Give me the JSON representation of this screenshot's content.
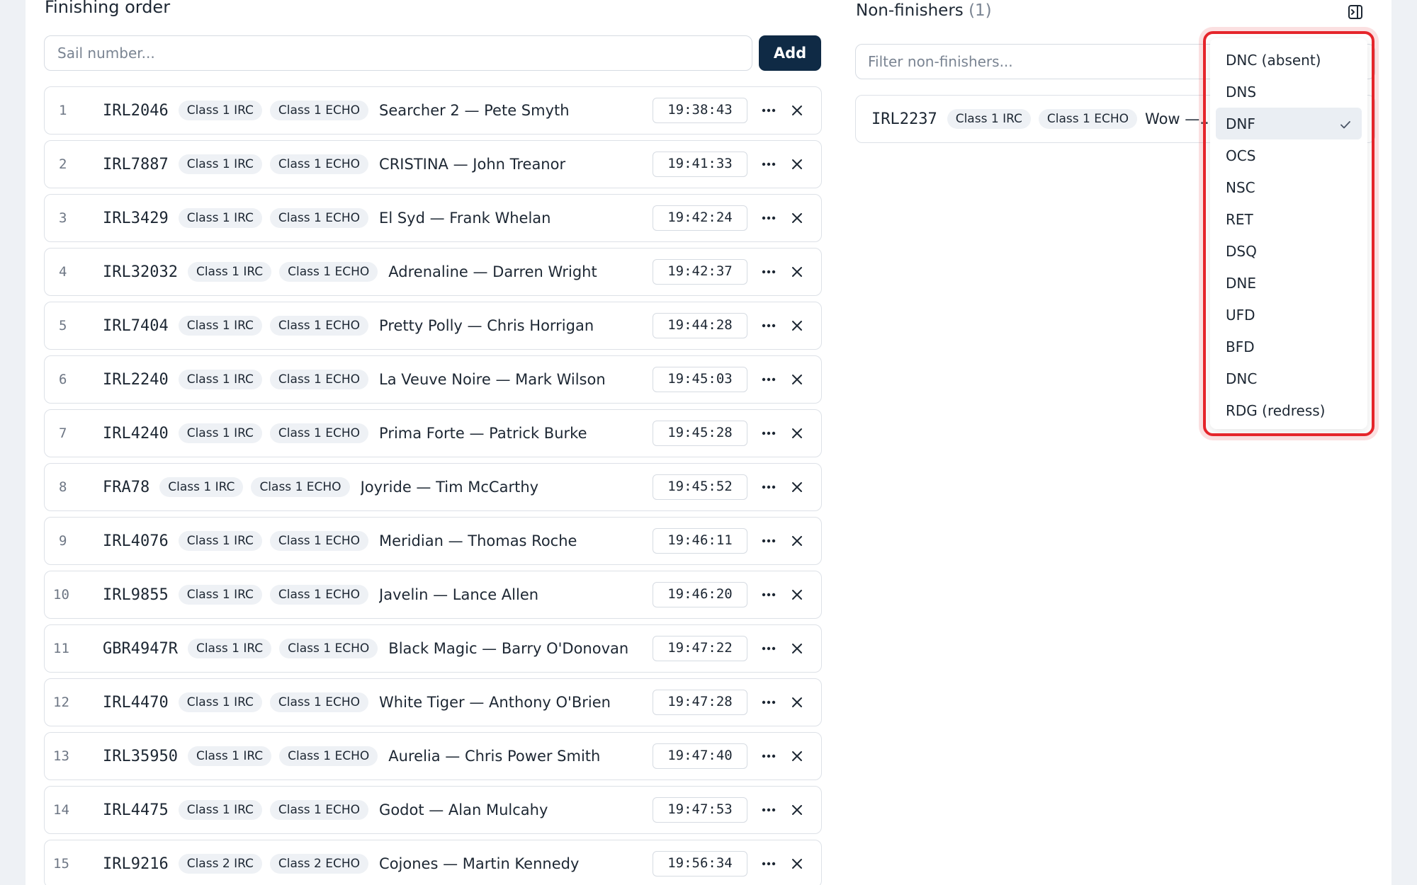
{
  "finishing": {
    "title": "Finishing order",
    "sail_placeholder": "Sail number...",
    "add_label": "Add",
    "rows": [
      {
        "pos": "1",
        "sail": "IRL2046",
        "chips": [
          "Class 1 IRC",
          "Class 1 ECHO"
        ],
        "boat": "Searcher 2 — Pete Smyth",
        "time": "19:38:43"
      },
      {
        "pos": "2",
        "sail": "IRL7887",
        "chips": [
          "Class 1 IRC",
          "Class 1 ECHO"
        ],
        "boat": "CRISTINA — John Treanor",
        "time": "19:41:33"
      },
      {
        "pos": "3",
        "sail": "IRL3429",
        "chips": [
          "Class 1 IRC",
          "Class 1 ECHO"
        ],
        "boat": "El Syd — Frank Whelan",
        "time": "19:42:24"
      },
      {
        "pos": "4",
        "sail": "IRL32032",
        "chips": [
          "Class 1 IRC",
          "Class 1 ECHO"
        ],
        "boat": "Adrenaline — Darren Wright",
        "time": "19:42:37"
      },
      {
        "pos": "5",
        "sail": "IRL7404",
        "chips": [
          "Class 1 IRC",
          "Class 1 ECHO"
        ],
        "boat": "Pretty Polly — Chris Horrigan",
        "time": "19:44:28"
      },
      {
        "pos": "6",
        "sail": "IRL2240",
        "chips": [
          "Class 1 IRC",
          "Class 1 ECHO"
        ],
        "boat": "La Veuve Noire — Mark Wilson",
        "time": "19:45:03"
      },
      {
        "pos": "7",
        "sail": "IRL4240",
        "chips": [
          "Class 1 IRC",
          "Class 1 ECHO"
        ],
        "boat": "Prima Forte — Patrick Burke",
        "time": "19:45:28"
      },
      {
        "pos": "8",
        "sail": "FRA78",
        "chips": [
          "Class 1 IRC",
          "Class 1 ECHO"
        ],
        "boat": "Joyride — Tim McCarthy",
        "time": "19:45:52"
      },
      {
        "pos": "9",
        "sail": "IRL4076",
        "chips": [
          "Class 1 IRC",
          "Class 1 ECHO"
        ],
        "boat": "Meridian — Thomas Roche",
        "time": "19:46:11"
      },
      {
        "pos": "10",
        "sail": "IRL9855",
        "chips": [
          "Class 1 IRC",
          "Class 1 ECHO"
        ],
        "boat": "Javelin — Lance Allen",
        "time": "19:46:20"
      },
      {
        "pos": "11",
        "sail": "GBR4947R",
        "chips": [
          "Class 1 IRC",
          "Class 1 ECHO"
        ],
        "boat": "Black Magic — Barry O'Donovan",
        "time": "19:47:22"
      },
      {
        "pos": "12",
        "sail": "IRL4470",
        "chips": [
          "Class 1 IRC",
          "Class 1 ECHO"
        ],
        "boat": "White Tiger — Anthony O'Brien",
        "time": "19:47:28"
      },
      {
        "pos": "13",
        "sail": "IRL35950",
        "chips": [
          "Class 1 IRC",
          "Class 1 ECHO"
        ],
        "boat": "Aurelia — Chris Power Smith",
        "time": "19:47:40"
      },
      {
        "pos": "14",
        "sail": "IRL4475",
        "chips": [
          "Class 1 IRC",
          "Class 1 ECHO"
        ],
        "boat": "Godot — Alan Mulcahy",
        "time": "19:47:53"
      },
      {
        "pos": "15",
        "sail": "IRL9216",
        "chips": [
          "Class 2 IRC",
          "Class 2 ECHO"
        ],
        "boat": "Cojones — Martin Kennedy",
        "time": "19:56:34"
      }
    ]
  },
  "non_finishers": {
    "title": "Non-finishers",
    "count": "(1)",
    "filter_placeholder": "Filter non-finishers...",
    "rows": [
      {
        "sail": "IRL2237",
        "chips": [
          "Class 1 IRC",
          "Class 1 ECHO"
        ],
        "boat": "Wow —..."
      }
    ]
  },
  "status_dropdown": {
    "selected": "DNF",
    "options": [
      "DNC (absent)",
      "DNS",
      "DNF",
      "OCS",
      "NSC",
      "RET",
      "DSQ",
      "DNE",
      "UFD",
      "BFD",
      "DNC",
      "RDG (redress)"
    ]
  },
  "icons": {
    "row_menu": "more-horizontal-icon",
    "row_remove": "close-icon",
    "panel_toggle": "panel-collapse-icon",
    "selected_check": "check-icon"
  },
  "colors": {
    "primary_button": "#0f2a45",
    "highlight": "#e5252b",
    "chip_bg": "#eef1f5"
  }
}
